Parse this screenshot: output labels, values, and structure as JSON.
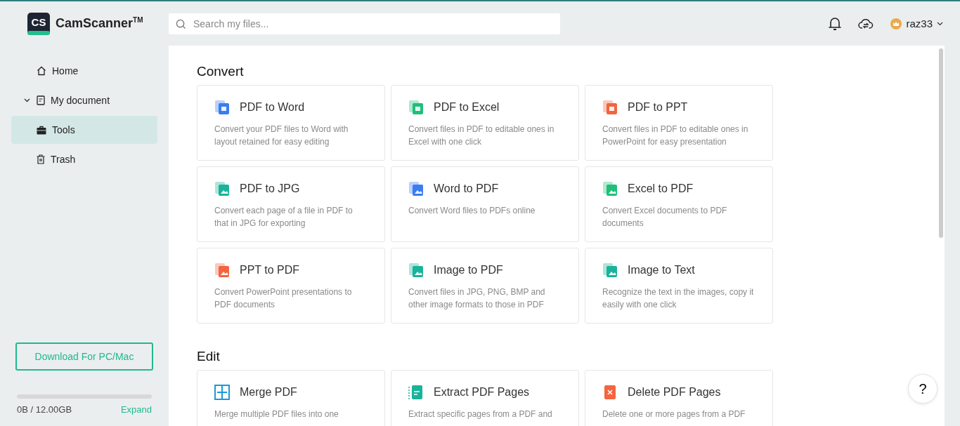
{
  "header": {
    "logo_text": "CS",
    "brand": "CamScanner",
    "trademark": "TM",
    "search": {
      "placeholder": "Search my files..."
    },
    "user": {
      "name": "raz33"
    }
  },
  "sidebar": {
    "items": [
      {
        "label": "Home",
        "kind": "home",
        "selected": false
      },
      {
        "label": "My document",
        "kind": "document",
        "selected": false,
        "expanded": true
      },
      {
        "label": "Tools",
        "kind": "tools",
        "selected": true
      },
      {
        "label": "Trash",
        "kind": "trash",
        "selected": false
      }
    ],
    "download_button": "Download For PC/Mac",
    "storage": {
      "level": 0,
      "usage": "0B / 12.00GB",
      "expand_link": "Expand"
    }
  },
  "sections": [
    {
      "title": "Convert",
      "tools": [
        {
          "kind": "word",
          "name": "PDF to Word",
          "description": "Convert your PDF files to Word with layout retained for easy editing"
        },
        {
          "kind": "excel",
          "name": "PDF to Excel",
          "description": "Convert files in PDF to editable ones in Excel with one click"
        },
        {
          "kind": "ppt",
          "name": "PDF to PPT",
          "description": "Convert files in PDF to editable ones in PowerPoint for easy presentation"
        },
        {
          "kind": "jpg",
          "name": "PDF to JPG",
          "description": "Convert each page of a file in PDF to that in JPG for exporting"
        },
        {
          "kind": "word-pdf",
          "name": "Word to PDF",
          "description": "Convert Word files to PDFs online"
        },
        {
          "kind": "excel-pdf",
          "name": "Excel to PDF",
          "description": "Convert Excel documents to PDF documents"
        },
        {
          "kind": "ppt-pdf",
          "name": "PPT to PDF",
          "description": "Convert PowerPoint presentations to PDF documents"
        },
        {
          "kind": "image-pdf",
          "name": "Image to PDF",
          "description": "Convert files in JPG, PNG, BMP and other image formats to those in PDF"
        },
        {
          "kind": "image-text",
          "name": "Image to Text",
          "description": "Recognize the text in the images, copy it easily with one click"
        }
      ]
    },
    {
      "title": "Edit",
      "tools": [
        {
          "kind": "merge",
          "name": "Merge PDF",
          "description": "Merge multiple PDF files into one"
        },
        {
          "kind": "extract",
          "name": "Extract PDF Pages",
          "description": "Extract specific pages from a PDF and"
        },
        {
          "kind": "delete",
          "name": "Delete PDF Pages",
          "description": "Delete one or more pages from a PDF"
        }
      ]
    }
  ],
  "help_button": "?"
}
